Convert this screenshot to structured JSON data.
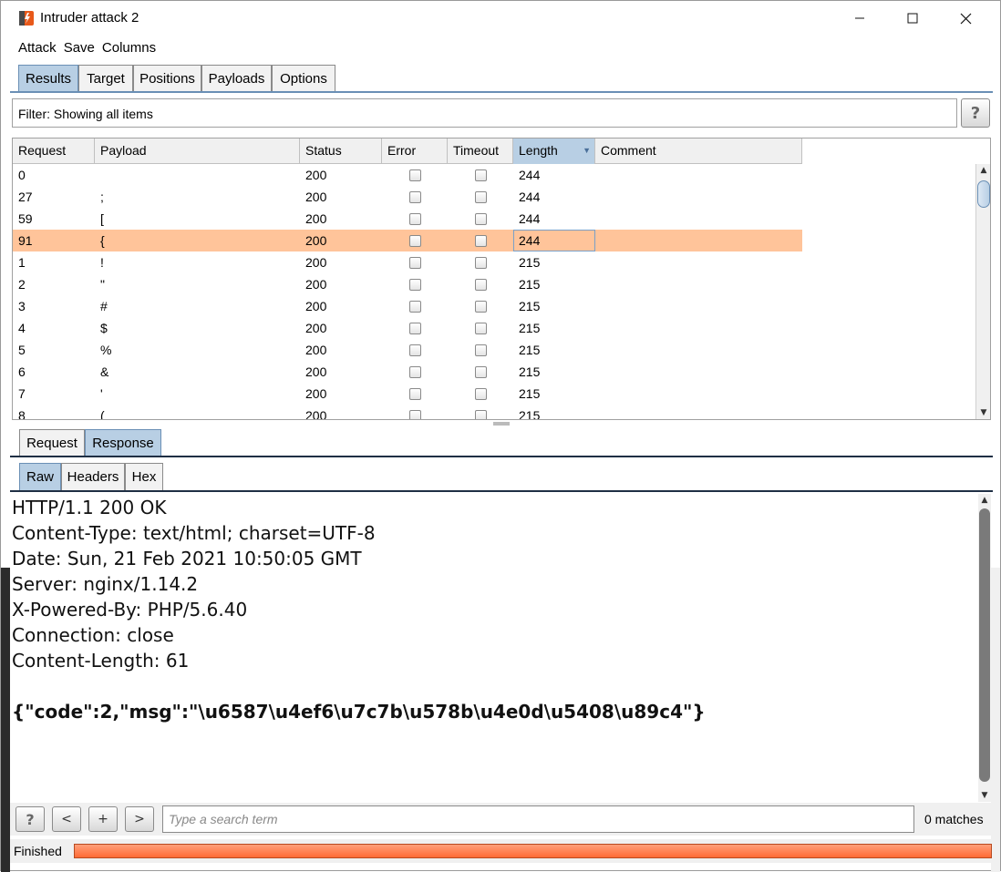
{
  "window": {
    "title": "Intruder attack 2"
  },
  "menu": [
    "Attack",
    "Save",
    "Columns"
  ],
  "tabs": [
    {
      "label": "Results",
      "active": true
    },
    {
      "label": "Target",
      "active": false
    },
    {
      "label": "Positions",
      "active": false
    },
    {
      "label": "Payloads",
      "active": false
    },
    {
      "label": "Options",
      "active": false
    }
  ],
  "filter": {
    "text": "Filter: Showing all items",
    "help_label": "?"
  },
  "table": {
    "columns": [
      "Request",
      "Payload",
      "Status",
      "Error",
      "Timeout",
      "Length",
      "Comment"
    ],
    "sorted_column": "Length",
    "rows": [
      {
        "request": "0",
        "payload": "",
        "status": "200",
        "error": false,
        "timeout": false,
        "length": "244",
        "comment": ""
      },
      {
        "request": "27",
        "payload": ";",
        "status": "200",
        "error": false,
        "timeout": false,
        "length": "244",
        "comment": ""
      },
      {
        "request": "59",
        "payload": "[",
        "status": "200",
        "error": false,
        "timeout": false,
        "length": "244",
        "comment": ""
      },
      {
        "request": "91",
        "payload": "{",
        "status": "200",
        "error": false,
        "timeout": false,
        "length": "244",
        "comment": "",
        "selected": true
      },
      {
        "request": "1",
        "payload": "!",
        "status": "200",
        "error": false,
        "timeout": false,
        "length": "215",
        "comment": ""
      },
      {
        "request": "2",
        "payload": "\"",
        "status": "200",
        "error": false,
        "timeout": false,
        "length": "215",
        "comment": ""
      },
      {
        "request": "3",
        "payload": "#",
        "status": "200",
        "error": false,
        "timeout": false,
        "length": "215",
        "comment": ""
      },
      {
        "request": "4",
        "payload": "$",
        "status": "200",
        "error": false,
        "timeout": false,
        "length": "215",
        "comment": ""
      },
      {
        "request": "5",
        "payload": "%",
        "status": "200",
        "error": false,
        "timeout": false,
        "length": "215",
        "comment": ""
      },
      {
        "request": "6",
        "payload": "&",
        "status": "200",
        "error": false,
        "timeout": false,
        "length": "215",
        "comment": ""
      },
      {
        "request": "7",
        "payload": "'",
        "status": "200",
        "error": false,
        "timeout": false,
        "length": "215",
        "comment": ""
      },
      {
        "request": "8",
        "payload": "(",
        "status": "200",
        "error": false,
        "timeout": false,
        "length": "215",
        "comment": ""
      }
    ]
  },
  "detail_tabs": [
    {
      "label": "Request",
      "active": false
    },
    {
      "label": "Response",
      "active": true
    }
  ],
  "view_tabs": [
    {
      "label": "Raw",
      "active": true
    },
    {
      "label": "Headers",
      "active": false
    },
    {
      "label": "Hex",
      "active": false
    }
  ],
  "response": {
    "lines": [
      "HTTP/1.1 200 OK",
      "Content-Type: text/html; charset=UTF-8",
      "Date: Sun, 21 Feb 2021 10:50:05 GMT",
      "Server: nginx/1.14.2",
      "X-Powered-By: PHP/5.6.40",
      "Connection: close",
      "Content-Length: 61"
    ],
    "body": "{\"code\":2,\"msg\":\"\\u6587\\u4ef6\\u7c7b\\u578b\\u4e0d\\u5408\\u89c4\"}"
  },
  "search": {
    "buttons": [
      "?",
      "<",
      "+",
      ">"
    ],
    "placeholder": "Type a search term",
    "value": "",
    "matches": "0 matches"
  },
  "status": {
    "label": "Finished",
    "progress": 1.0
  },
  "colors": {
    "selected_row": "#ffc49a",
    "active_tab": "#b8cfe4",
    "progress": "#ff6a35"
  },
  "icons": {
    "app": "burp-logo-icon",
    "minimize": "minimize-icon",
    "maximize": "maximize-icon",
    "close": "close-icon"
  }
}
